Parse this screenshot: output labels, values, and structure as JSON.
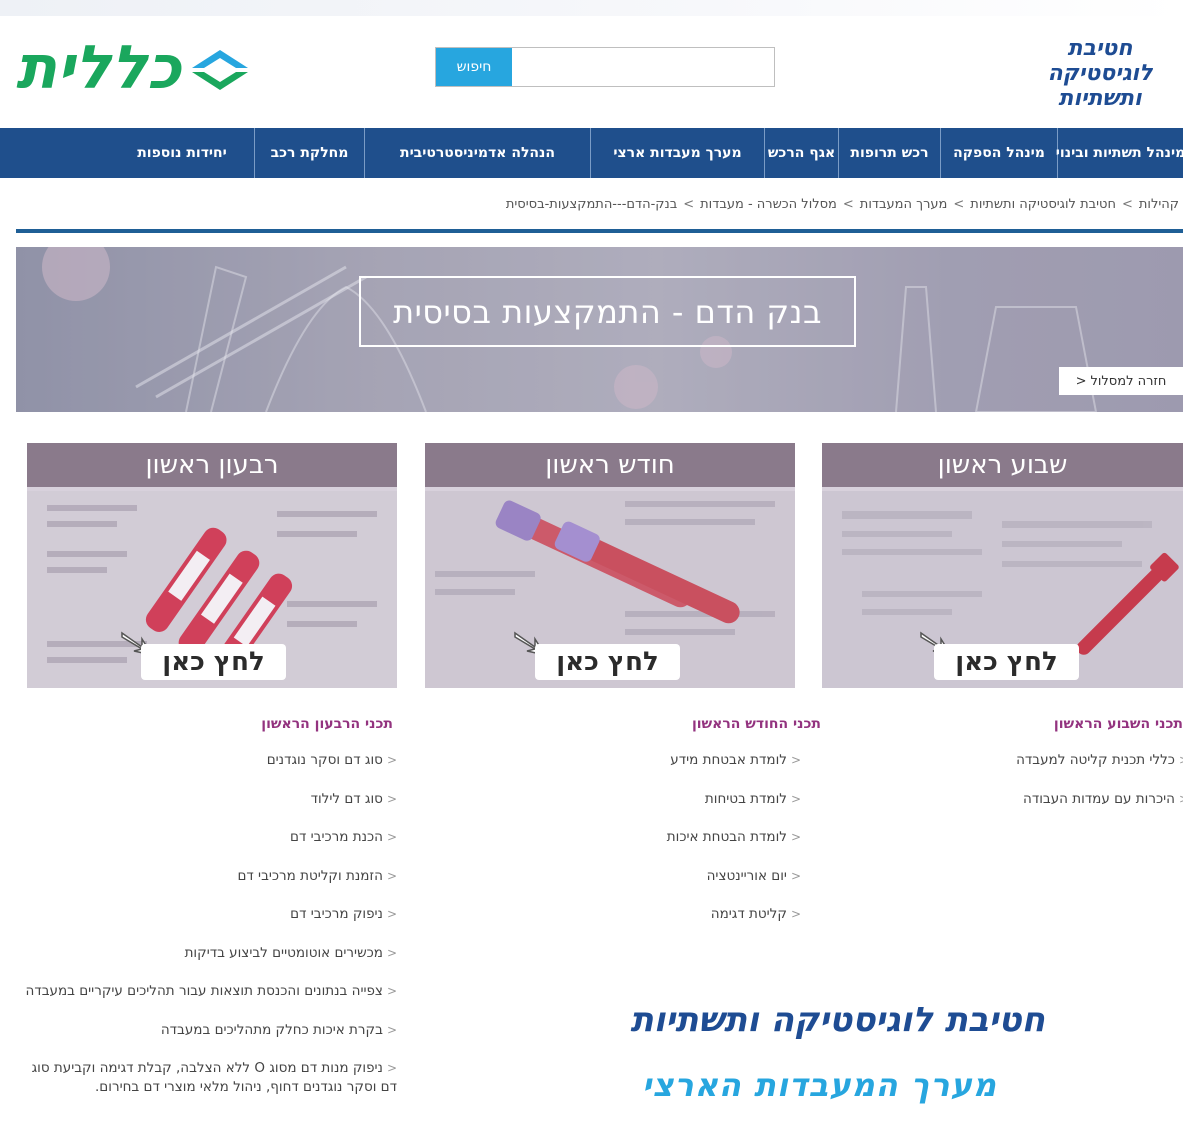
{
  "header": {
    "brand_lines": [
      "חטיבת",
      "לוגיסטיקה",
      "ותשתיות"
    ],
    "logo_text": "כללית",
    "search": {
      "button": "חיפוש",
      "value": "",
      "placeholder": ""
    }
  },
  "nav": {
    "items": [
      "מינהל תשתיות ובינוי",
      "מינהל הספקה",
      "רכש תרופות",
      "אגף הרכש",
      "מערך מעבדות ארצי",
      "הנהלה אדמיניסטרטיבית",
      "מחלקת רכב",
      "יחידות נוספות"
    ]
  },
  "breadcrumb": [
    "קהילות",
    "חטיבת לוגיסטיקה ותשתיות",
    "מערך המעבדות",
    "מסלול הכשרה - מעבדות",
    "בנק-הדם---התמקצעות-בסיסית"
  ],
  "hero": {
    "title": "בנק הדם - התמקצעות בסיסית",
    "back_label": "חזרה למסלול"
  },
  "cards": [
    {
      "heading": "שבוע ראשון",
      "button": "לחץ כאן"
    },
    {
      "heading": "חודש ראשון",
      "button": "לחץ כאן"
    },
    {
      "heading": "רבעון ראשון",
      "button": "לחץ כאן"
    }
  ],
  "columns": {
    "week": {
      "title": "תכני השבוע הראשון",
      "items": [
        "כללי תכנית קליטה למעבדה",
        "היכרות עם עמדות העבודה"
      ]
    },
    "month": {
      "title": "תכני החודש הראשון",
      "items": [
        "לומדת אבטחת מידע",
        "לומדת בטיחות",
        "לומדת הבטחת איכות",
        "יום אוריינטציה",
        "קליטת דגימה"
      ]
    },
    "quarter": {
      "title": "תכני הרבעון הראשון",
      "items": [
        "סוג דם וסקר נוגדנים",
        "סוג דם לילוד",
        "הכנת מרכיבי דם",
        "הזמנת וקליטת מרכיבי דם",
        "ניפוק מרכיבי דם",
        "מכשירים אוטומטיים לביצוע בדיקות",
        "צפייה בנתונים והכנסת תוצאות עבור תהליכים עיקריים במעבדה",
        "בקרת איכות כחלק מתהליכים במעבדה",
        "ניפוק מנות דם מסוג O ללא הצלבה, קבלת דגימה וקביעת סוג דם וסקר נוגדנים דחוף, ניהול מלאי מוצרי דם בחירום."
      ]
    }
  },
  "footer": {
    "division": "חטיבת לוגיסטיקה ותשתיות",
    "lab": "מערך המעבדות הארצי"
  },
  "colors": {
    "nav_bg": "#1f4f8c",
    "search_button": "#27a6df",
    "logo_green": "#1aa75d",
    "brand_blue": "#1e4c93",
    "card_header": "#8a7a8b",
    "section_title": "#93337f",
    "footer_lab": "#27a6df"
  }
}
